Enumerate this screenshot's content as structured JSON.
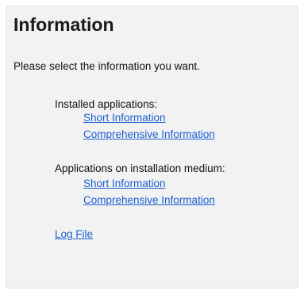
{
  "page": {
    "title": "Information",
    "intro": "Please select the information you want."
  },
  "groups": [
    {
      "label": "Installed applications:",
      "links": [
        "Short Information",
        "Comprehensive Information"
      ]
    },
    {
      "label": "Applications on installation medium:",
      "links": [
        "Short Information",
        "Comprehensive Information"
      ]
    }
  ],
  "log_link": "Log File",
  "colors": {
    "panel_background": "#f2f2f2",
    "link": "#1a5fd1",
    "text": "#111111"
  }
}
